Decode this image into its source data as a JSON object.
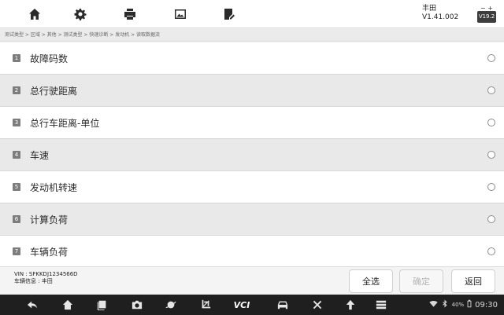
{
  "header": {
    "brand": "丰田",
    "version": "V1.41.002",
    "vci_version": "V19.2"
  },
  "breadcrumb": "测试类型 > 区域 > 其他 > 测试类型 > 快速诊断 > 发动机 > 读取数据流",
  "list": {
    "items": [
      {
        "index": "1",
        "label": "故障码数"
      },
      {
        "index": "2",
        "label": "总行驶距离"
      },
      {
        "index": "3",
        "label": "总行车距离-单位"
      },
      {
        "index": "4",
        "label": "车速"
      },
      {
        "index": "5",
        "label": "发动机转速"
      },
      {
        "index": "6",
        "label": "计算负荷"
      },
      {
        "index": "7",
        "label": "车辆负荷"
      }
    ]
  },
  "footer": {
    "vin_line": "VIN : SFKKDJ1234566D",
    "vehicle_line": "车辆信息 : 丰田",
    "select_all_label": "全选",
    "confirm_label": "确定",
    "back_label": "返回"
  },
  "navbar": {
    "vci_label": "VCI",
    "battery_text": "40%",
    "time": "09:30"
  }
}
